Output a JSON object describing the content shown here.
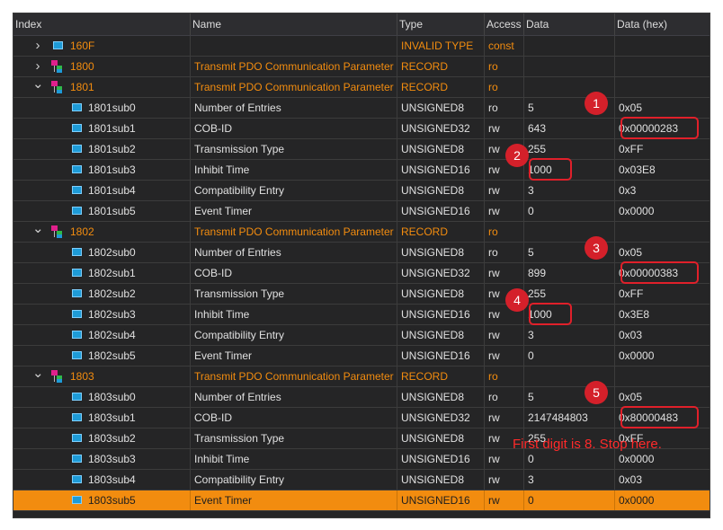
{
  "columns": [
    "Index",
    "Name",
    "Type",
    "Access",
    "Data",
    "Data (hex)"
  ],
  "rows": [
    {
      "kind": "rec",
      "expanded": false,
      "index": "160F",
      "name": "",
      "type": "INVALID TYPE",
      "access": "const",
      "data": "",
      "hex": "",
      "icon": "object-icon"
    },
    {
      "kind": "rec",
      "expanded": false,
      "index": "1800",
      "name": "Transmit PDO Communication Parameter",
      "type": "RECORD",
      "access": "ro",
      "data": "",
      "hex": "",
      "icon": "record-icon"
    },
    {
      "kind": "rec",
      "expanded": true,
      "index": "1801",
      "name": "Transmit PDO Communication Parameter",
      "type": "RECORD",
      "access": "ro",
      "data": "",
      "hex": "",
      "icon": "record-icon"
    },
    {
      "kind": "sub",
      "index": "1801sub0",
      "name": "Number of Entries",
      "type": "UNSIGNED8",
      "access": "ro",
      "data": "5",
      "hex": "0x05"
    },
    {
      "kind": "sub",
      "index": "1801sub1",
      "name": "COB-ID",
      "type": "UNSIGNED32",
      "access": "rw",
      "data": "643",
      "hex": "0x00000283"
    },
    {
      "kind": "sub",
      "index": "1801sub2",
      "name": "Transmission Type",
      "type": "UNSIGNED8",
      "access": "rw",
      "data": "255",
      "hex": "0xFF"
    },
    {
      "kind": "sub",
      "index": "1801sub3",
      "name": "Inhibit Time",
      "type": "UNSIGNED16",
      "access": "rw",
      "data": "1000",
      "hex": "0x03E8"
    },
    {
      "kind": "sub",
      "index": "1801sub4",
      "name": "Compatibility Entry",
      "type": "UNSIGNED8",
      "access": "rw",
      "data": "3",
      "hex": "0x3"
    },
    {
      "kind": "sub",
      "index": "1801sub5",
      "name": "Event Timer",
      "type": "UNSIGNED16",
      "access": "rw",
      "data": "0",
      "hex": "0x0000"
    },
    {
      "kind": "rec",
      "expanded": true,
      "index": "1802",
      "name": "Transmit PDO Communication Parameter",
      "type": "RECORD",
      "access": "ro",
      "data": "",
      "hex": "",
      "icon": "record-icon"
    },
    {
      "kind": "sub",
      "index": "1802sub0",
      "name": "Number of Entries",
      "type": "UNSIGNED8",
      "access": "ro",
      "data": "5",
      "hex": "0x05"
    },
    {
      "kind": "sub",
      "index": "1802sub1",
      "name": "COB-ID",
      "type": "UNSIGNED32",
      "access": "rw",
      "data": "899",
      "hex": "0x00000383"
    },
    {
      "kind": "sub",
      "index": "1802sub2",
      "name": "Transmission Type",
      "type": "UNSIGNED8",
      "access": "rw",
      "data": "255",
      "hex": "0xFF"
    },
    {
      "kind": "sub",
      "index": "1802sub3",
      "name": "Inhibit Time",
      "type": "UNSIGNED16",
      "access": "rw",
      "data": "1000",
      "hex": "0x3E8"
    },
    {
      "kind": "sub",
      "index": "1802sub4",
      "name": "Compatibility Entry",
      "type": "UNSIGNED8",
      "access": "rw",
      "data": "3",
      "hex": "0x03"
    },
    {
      "kind": "sub",
      "index": "1802sub5",
      "name": "Event Timer",
      "type": "UNSIGNED16",
      "access": "rw",
      "data": "0",
      "hex": "0x0000"
    },
    {
      "kind": "rec",
      "expanded": true,
      "index": "1803",
      "name": "Transmit PDO Communication Parameter",
      "type": "RECORD",
      "access": "ro",
      "data": "",
      "hex": "",
      "icon": "record-icon"
    },
    {
      "kind": "sub",
      "index": "1803sub0",
      "name": "Number of Entries",
      "type": "UNSIGNED8",
      "access": "ro",
      "data": "5",
      "hex": "0x05"
    },
    {
      "kind": "sub",
      "index": "1803sub1",
      "name": "COB-ID",
      "type": "UNSIGNED32",
      "access": "rw",
      "data": "2147484803",
      "hex": "0x80000483"
    },
    {
      "kind": "sub",
      "index": "1803sub2",
      "name": "Transmission Type",
      "type": "UNSIGNED8",
      "access": "rw",
      "data": "255",
      "hex": "0xFF"
    },
    {
      "kind": "sub",
      "index": "1803sub3",
      "name": "Inhibit Time",
      "type": "UNSIGNED16",
      "access": "rw",
      "data": "0",
      "hex": "0x0000"
    },
    {
      "kind": "sub",
      "index": "1803sub4",
      "name": "Compatibility Entry",
      "type": "UNSIGNED8",
      "access": "rw",
      "data": "3",
      "hex": "0x03"
    },
    {
      "kind": "sub",
      "index": "1803sub5",
      "name": "Event Timer",
      "type": "UNSIGNED16",
      "access": "rw",
      "data": "0",
      "hex": "0x0000",
      "selected": true
    }
  ],
  "callouts": [
    {
      "number": "1",
      "row": "1801sub1",
      "column": "Data (hex)"
    },
    {
      "number": "2",
      "row": "1801sub3",
      "column": "Data"
    },
    {
      "number": "3",
      "row": "1802sub1",
      "column": "Data (hex)"
    },
    {
      "number": "4",
      "row": "1802sub3",
      "column": "Data"
    },
    {
      "number": "5",
      "row": "1803sub1",
      "column": "Data (hex)"
    }
  ],
  "note": "First digit is 8. Stop here.",
  "colors": {
    "background": "#252526",
    "header": "#2d2d30",
    "accent_orange": "#f28c0f",
    "callout_red": "#d4202a",
    "icon_blue": "#1e9bd7",
    "icon_magenta": "#e0208c",
    "icon_green": "#2fb84a"
  }
}
